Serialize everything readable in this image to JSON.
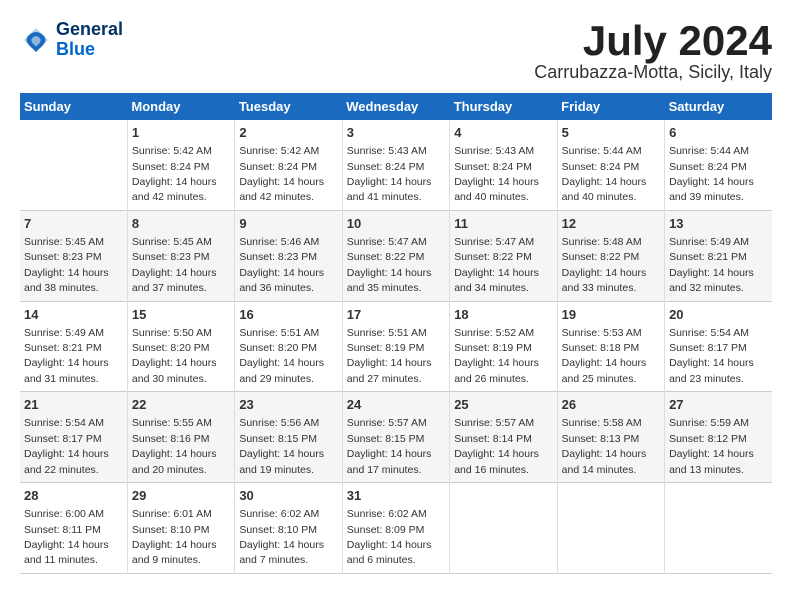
{
  "logo": {
    "line1": "General",
    "line2": "Blue"
  },
  "title": "July 2024",
  "location": "Carrubazza-Motta, Sicily, Italy",
  "headers": [
    "Sunday",
    "Monday",
    "Tuesday",
    "Wednesday",
    "Thursday",
    "Friday",
    "Saturday"
  ],
  "weeks": [
    [
      {
        "day": "",
        "sunrise": "",
        "sunset": "",
        "daylight": ""
      },
      {
        "day": "1",
        "sunrise": "Sunrise: 5:42 AM",
        "sunset": "Sunset: 8:24 PM",
        "daylight": "Daylight: 14 hours and 42 minutes."
      },
      {
        "day": "2",
        "sunrise": "Sunrise: 5:42 AM",
        "sunset": "Sunset: 8:24 PM",
        "daylight": "Daylight: 14 hours and 42 minutes."
      },
      {
        "day": "3",
        "sunrise": "Sunrise: 5:43 AM",
        "sunset": "Sunset: 8:24 PM",
        "daylight": "Daylight: 14 hours and 41 minutes."
      },
      {
        "day": "4",
        "sunrise": "Sunrise: 5:43 AM",
        "sunset": "Sunset: 8:24 PM",
        "daylight": "Daylight: 14 hours and 40 minutes."
      },
      {
        "day": "5",
        "sunrise": "Sunrise: 5:44 AM",
        "sunset": "Sunset: 8:24 PM",
        "daylight": "Daylight: 14 hours and 40 minutes."
      },
      {
        "day": "6",
        "sunrise": "Sunrise: 5:44 AM",
        "sunset": "Sunset: 8:24 PM",
        "daylight": "Daylight: 14 hours and 39 minutes."
      }
    ],
    [
      {
        "day": "7",
        "sunrise": "Sunrise: 5:45 AM",
        "sunset": "Sunset: 8:23 PM",
        "daylight": "Daylight: 14 hours and 38 minutes."
      },
      {
        "day": "8",
        "sunrise": "Sunrise: 5:45 AM",
        "sunset": "Sunset: 8:23 PM",
        "daylight": "Daylight: 14 hours and 37 minutes."
      },
      {
        "day": "9",
        "sunrise": "Sunrise: 5:46 AM",
        "sunset": "Sunset: 8:23 PM",
        "daylight": "Daylight: 14 hours and 36 minutes."
      },
      {
        "day": "10",
        "sunrise": "Sunrise: 5:47 AM",
        "sunset": "Sunset: 8:22 PM",
        "daylight": "Daylight: 14 hours and 35 minutes."
      },
      {
        "day": "11",
        "sunrise": "Sunrise: 5:47 AM",
        "sunset": "Sunset: 8:22 PM",
        "daylight": "Daylight: 14 hours and 34 minutes."
      },
      {
        "day": "12",
        "sunrise": "Sunrise: 5:48 AM",
        "sunset": "Sunset: 8:22 PM",
        "daylight": "Daylight: 14 hours and 33 minutes."
      },
      {
        "day": "13",
        "sunrise": "Sunrise: 5:49 AM",
        "sunset": "Sunset: 8:21 PM",
        "daylight": "Daylight: 14 hours and 32 minutes."
      }
    ],
    [
      {
        "day": "14",
        "sunrise": "Sunrise: 5:49 AM",
        "sunset": "Sunset: 8:21 PM",
        "daylight": "Daylight: 14 hours and 31 minutes."
      },
      {
        "day": "15",
        "sunrise": "Sunrise: 5:50 AM",
        "sunset": "Sunset: 8:20 PM",
        "daylight": "Daylight: 14 hours and 30 minutes."
      },
      {
        "day": "16",
        "sunrise": "Sunrise: 5:51 AM",
        "sunset": "Sunset: 8:20 PM",
        "daylight": "Daylight: 14 hours and 29 minutes."
      },
      {
        "day": "17",
        "sunrise": "Sunrise: 5:51 AM",
        "sunset": "Sunset: 8:19 PM",
        "daylight": "Daylight: 14 hours and 27 minutes."
      },
      {
        "day": "18",
        "sunrise": "Sunrise: 5:52 AM",
        "sunset": "Sunset: 8:19 PM",
        "daylight": "Daylight: 14 hours and 26 minutes."
      },
      {
        "day": "19",
        "sunrise": "Sunrise: 5:53 AM",
        "sunset": "Sunset: 8:18 PM",
        "daylight": "Daylight: 14 hours and 25 minutes."
      },
      {
        "day": "20",
        "sunrise": "Sunrise: 5:54 AM",
        "sunset": "Sunset: 8:17 PM",
        "daylight": "Daylight: 14 hours and 23 minutes."
      }
    ],
    [
      {
        "day": "21",
        "sunrise": "Sunrise: 5:54 AM",
        "sunset": "Sunset: 8:17 PM",
        "daylight": "Daylight: 14 hours and 22 minutes."
      },
      {
        "day": "22",
        "sunrise": "Sunrise: 5:55 AM",
        "sunset": "Sunset: 8:16 PM",
        "daylight": "Daylight: 14 hours and 20 minutes."
      },
      {
        "day": "23",
        "sunrise": "Sunrise: 5:56 AM",
        "sunset": "Sunset: 8:15 PM",
        "daylight": "Daylight: 14 hours and 19 minutes."
      },
      {
        "day": "24",
        "sunrise": "Sunrise: 5:57 AM",
        "sunset": "Sunset: 8:15 PM",
        "daylight": "Daylight: 14 hours and 17 minutes."
      },
      {
        "day": "25",
        "sunrise": "Sunrise: 5:57 AM",
        "sunset": "Sunset: 8:14 PM",
        "daylight": "Daylight: 14 hours and 16 minutes."
      },
      {
        "day": "26",
        "sunrise": "Sunrise: 5:58 AM",
        "sunset": "Sunset: 8:13 PM",
        "daylight": "Daylight: 14 hours and 14 minutes."
      },
      {
        "day": "27",
        "sunrise": "Sunrise: 5:59 AM",
        "sunset": "Sunset: 8:12 PM",
        "daylight": "Daylight: 14 hours and 13 minutes."
      }
    ],
    [
      {
        "day": "28",
        "sunrise": "Sunrise: 6:00 AM",
        "sunset": "Sunset: 8:11 PM",
        "daylight": "Daylight: 14 hours and 11 minutes."
      },
      {
        "day": "29",
        "sunrise": "Sunrise: 6:01 AM",
        "sunset": "Sunset: 8:10 PM",
        "daylight": "Daylight: 14 hours and 9 minutes."
      },
      {
        "day": "30",
        "sunrise": "Sunrise: 6:02 AM",
        "sunset": "Sunset: 8:10 PM",
        "daylight": "Daylight: 14 hours and 7 minutes."
      },
      {
        "day": "31",
        "sunrise": "Sunrise: 6:02 AM",
        "sunset": "Sunset: 8:09 PM",
        "daylight": "Daylight: 14 hours and 6 minutes."
      },
      {
        "day": "",
        "sunrise": "",
        "sunset": "",
        "daylight": ""
      },
      {
        "day": "",
        "sunrise": "",
        "sunset": "",
        "daylight": ""
      },
      {
        "day": "",
        "sunrise": "",
        "sunset": "",
        "daylight": ""
      }
    ]
  ]
}
